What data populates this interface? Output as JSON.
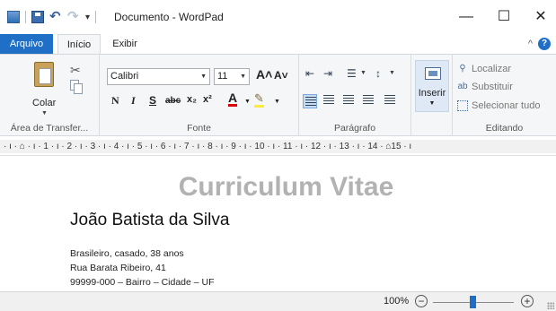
{
  "window": {
    "title": "Documento - WordPad",
    "minimize_glyph": "—",
    "maximize_glyph": "☐",
    "close_glyph": "✕"
  },
  "tabs": {
    "file": "Arquivo",
    "home": "Início",
    "view": "Exibir"
  },
  "ribbon": {
    "clipboard": {
      "paste": "Colar",
      "group": "Área de Transfer..."
    },
    "font": {
      "family": "Calibri",
      "size": "11",
      "bold": "N",
      "italic": "I",
      "underline": "S",
      "strike": "abc",
      "subscript": "x₂",
      "superscript": "x²",
      "color_letter": "A",
      "group": "Fonte"
    },
    "paragraph": {
      "group": "Parágrafo"
    },
    "insert": {
      "label": "Inserir"
    },
    "editing": {
      "find": "Localizar",
      "replace": "Substituir",
      "select_all": "Selecionar tudo",
      "group": "Editando"
    }
  },
  "ruler": {
    "text": "· ı · ⌂ · ı · 1 · ı · 2 · ı · 3 · ı · 4 · ı · 5 · ı · 6 · ı · 7 · ı · 8 · ı · 9 · ı · 10 · ı · 11 · ı · 12 · ı · 13 · ı · 14 · ⌂15 · ı"
  },
  "document": {
    "heading": "Curriculum Vitae",
    "name": "João Batista da Silva",
    "lines": [
      "Brasileiro, casado, 38 anos",
      "Rua Barata Ribeiro, 41",
      "99999-000 – Bairro – Cidade – UF"
    ]
  },
  "status": {
    "zoom": "100%",
    "zoom_level_percent": 100
  },
  "icons": {
    "app": "wordpad-app-icon",
    "save": "save-icon",
    "undo": "undo-icon",
    "redo": "redo-icon",
    "help": "help-icon",
    "paste": "paste-icon",
    "cut": "cut-icon",
    "copy": "copy-icon",
    "find": "binoculars-icon",
    "replace": "replace-icon",
    "select_all": "select-all-icon"
  },
  "colors": {
    "accent": "#1f6fc6",
    "heading": "#b2b2b2",
    "ribbon_bg": "#f5f6f7"
  }
}
